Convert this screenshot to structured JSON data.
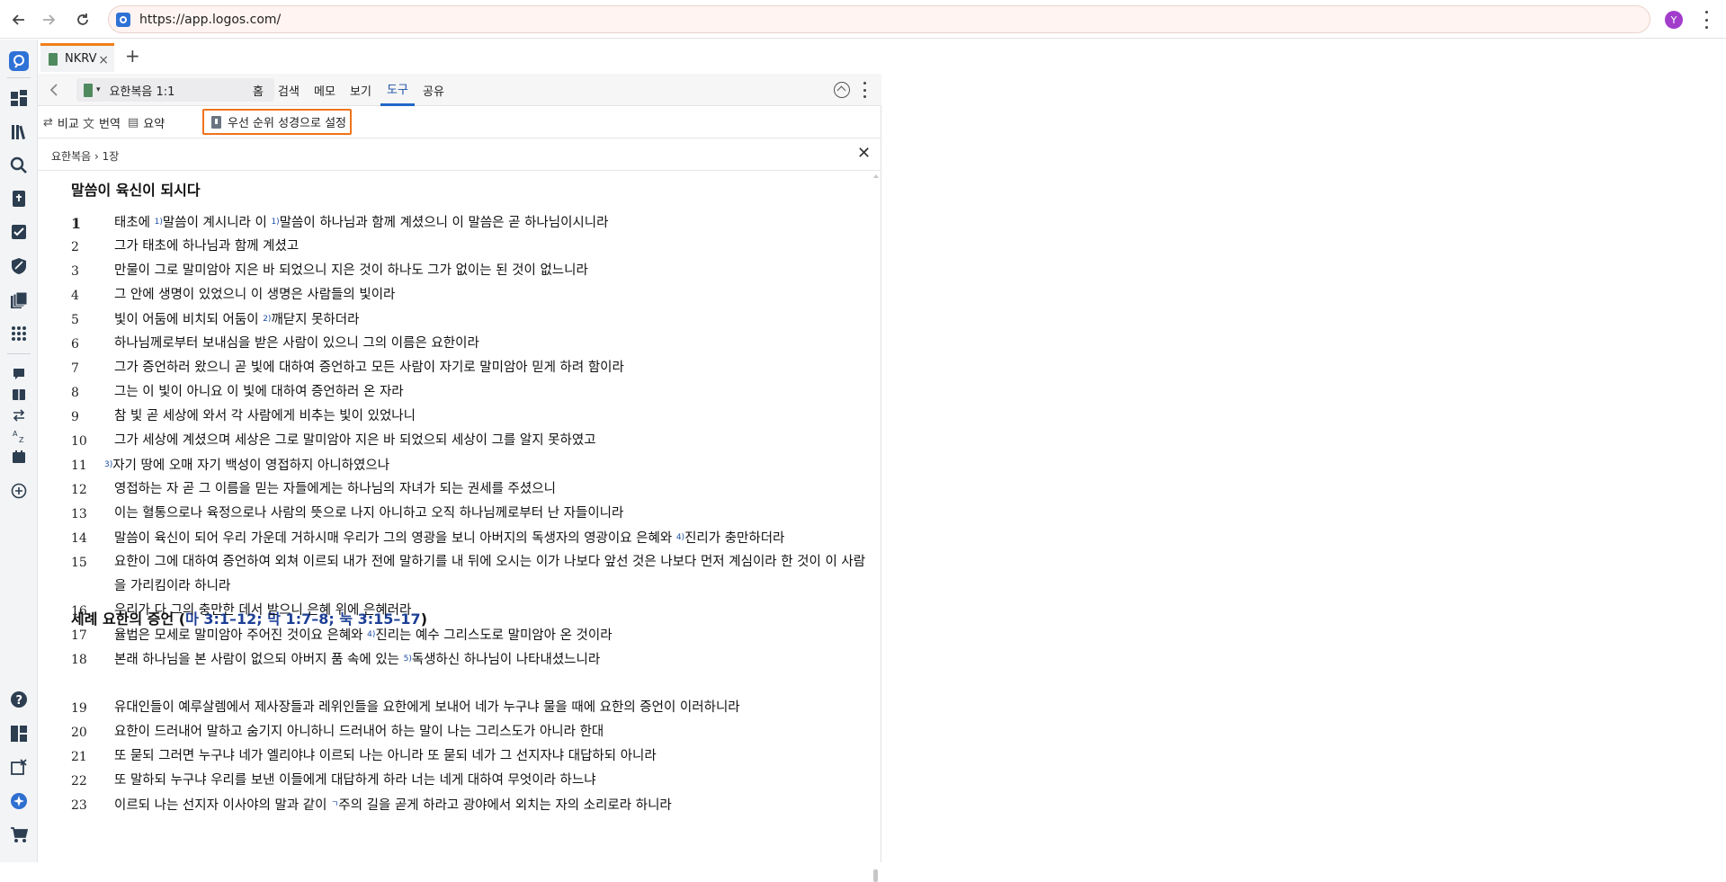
{
  "browser": {
    "url": "https://app.logos.com/",
    "profile_initial": "Y"
  },
  "tab": {
    "label": "NKRV",
    "close": "×",
    "new_tab": "+"
  },
  "panel": {
    "reference": "요한복음 1:1",
    "tabs": [
      "홈",
      "검색",
      "메모",
      "보기",
      "도구",
      "공유"
    ],
    "active_tab": "도구",
    "subtools": {
      "compare": "비교",
      "translate": "번역",
      "summary": "요약",
      "set_preferred": "우선 순위 성경으로 설정"
    },
    "breadcrumb": "요한복음 › 1장",
    "close": "✕"
  },
  "content": {
    "heading1": "말씀이 육신이 되시다",
    "heading2_text": "세례 요한의 증언 (",
    "heading2_refs": "마 3:1–12; 막 1:7–8; 눅 3:15–17",
    "heading2_close": ")",
    "verses": [
      {
        "n": "1",
        "parts": [
          "태초에 ",
          "1)",
          "말씀이 계시니라 이 ",
          "1)",
          "말씀이 하나님과 함께 계셨으니 이 말씀은 곧 하나님이시니라"
        ]
      },
      {
        "n": "2",
        "parts": [
          "그가 태초에 하나님과 함께 계셨고"
        ]
      },
      {
        "n": "3",
        "parts": [
          "만물이 그로 말미암아 지은 바 되었으니 지은 것이 하나도 그가 없이는 된 것이 없느니라"
        ]
      },
      {
        "n": "4",
        "parts": [
          "그 안에 생명이 있었으니 이 생명은 사람들의 빛이라"
        ]
      },
      {
        "n": "5",
        "parts": [
          "빛이 어둠에 비치되 어둠이 ",
          "2)",
          "깨닫지 못하더라"
        ]
      },
      {
        "n": "6",
        "parts": [
          "하나님께로부터 보내심을 받은 사람이 있으니 그의 이름은 요한이라"
        ]
      },
      {
        "n": "7",
        "parts": [
          "그가 증언하러 왔으니 곧 빛에 대하여 증언하고 모든 사람이 자기로 말미암아 믿게 하려 함이라"
        ]
      },
      {
        "n": "8",
        "parts": [
          "그는 이 빛이 아니요 이 빛에 대하여 증언하러 온 자라"
        ]
      },
      {
        "n": "9",
        "parts": [
          "참 빛 곧 세상에 와서 각 사람에게 비추는 빛이 있었나니"
        ]
      },
      {
        "n": "10",
        "parts": [
          "그가 세상에 계셨으며 세상은 그로 말미암아 지은 바 되었으되 세상이 그를 알지 못하였고"
        ]
      },
      {
        "n": "11",
        "parts": [
          "3)",
          "자기 땅에 오매 자기 백성이 영접하지 아니하였으나"
        ]
      },
      {
        "n": "12",
        "parts": [
          "영접하는 자 곧 그 이름을 믿는 자들에게는 하나님의 자녀가 되는 권세를 주셨으니"
        ]
      },
      {
        "n": "13",
        "parts": [
          "이는 혈통으로나 육정으로나 사람의 뜻으로 나지 아니하고 오직 하나님께로부터 난 자들이니라"
        ]
      },
      {
        "n": "14",
        "parts": [
          "말씀이 육신이 되어 우리 가운데 거하시매 우리가 그의 영광을 보니 아버지의 독생자의 영광이요 은혜와 ",
          "4)",
          "진리가 충만하더라"
        ]
      },
      {
        "n": "15",
        "parts": [
          "요한이 그에 대하여 증언하여 외쳐 이르되 내가 전에 말하기를 내 뒤에 오시는 이가 나보다 앞선 것은 나보다 먼저 계심이라 한 것이 이 사람을 가리킴이라 하니라"
        ]
      },
      {
        "n": "16",
        "parts": [
          "우리가 다 그의 충만한 데서 받으니 은혜 위에 은혜러라"
        ]
      },
      {
        "n": "17",
        "parts": [
          "율법은 모세로 말미암아 주어진 것이요 은혜와 ",
          "4)",
          "진리는 예수 그리스도로 말미암아 온 것이라"
        ]
      },
      {
        "n": "18",
        "parts": [
          "본래 하나님을 본 사람이 없으되 아버지 품 속에 있는 ",
          "5)",
          "독생하신 하나님이 나타내셨느니라"
        ]
      },
      {
        "n": "19",
        "parts": [
          "유대인들이 예루살렘에서 제사장들과 레위인들을 요한에게 보내어 네가 누구냐 물을 때에 요한의 증언이 이러하니라"
        ]
      },
      {
        "n": "20",
        "parts": [
          "요한이 드러내어 말하고 숨기지 아니하니 드러내어 하는 말이 나는 그리스도가 아니라 한대"
        ]
      },
      {
        "n": "21",
        "parts": [
          "또 묻되 그러면 누구냐 네가 엘리야냐 이르되 나는 아니라 또 묻되 네가 그 선지자냐 대답하되 아니라"
        ]
      },
      {
        "n": "22",
        "parts": [
          "또 말하되 누구냐 우리를 보낸 이들에게 대답하게 하라 너는 네게 대하여 무엇이라 하느냐"
        ]
      },
      {
        "n": "23",
        "parts": [
          "이르되 나는 선지자 이사야의 말과 같이 ",
          "ㄱ",
          "주의 길을 곧게 하라고 광야에서 외치는 자의 소리로라 하니라"
        ]
      }
    ]
  },
  "icons": {
    "accent": "#f0731a",
    "active_tab_color": "#2266c8",
    "app_logo_color": "#2f72d6"
  }
}
